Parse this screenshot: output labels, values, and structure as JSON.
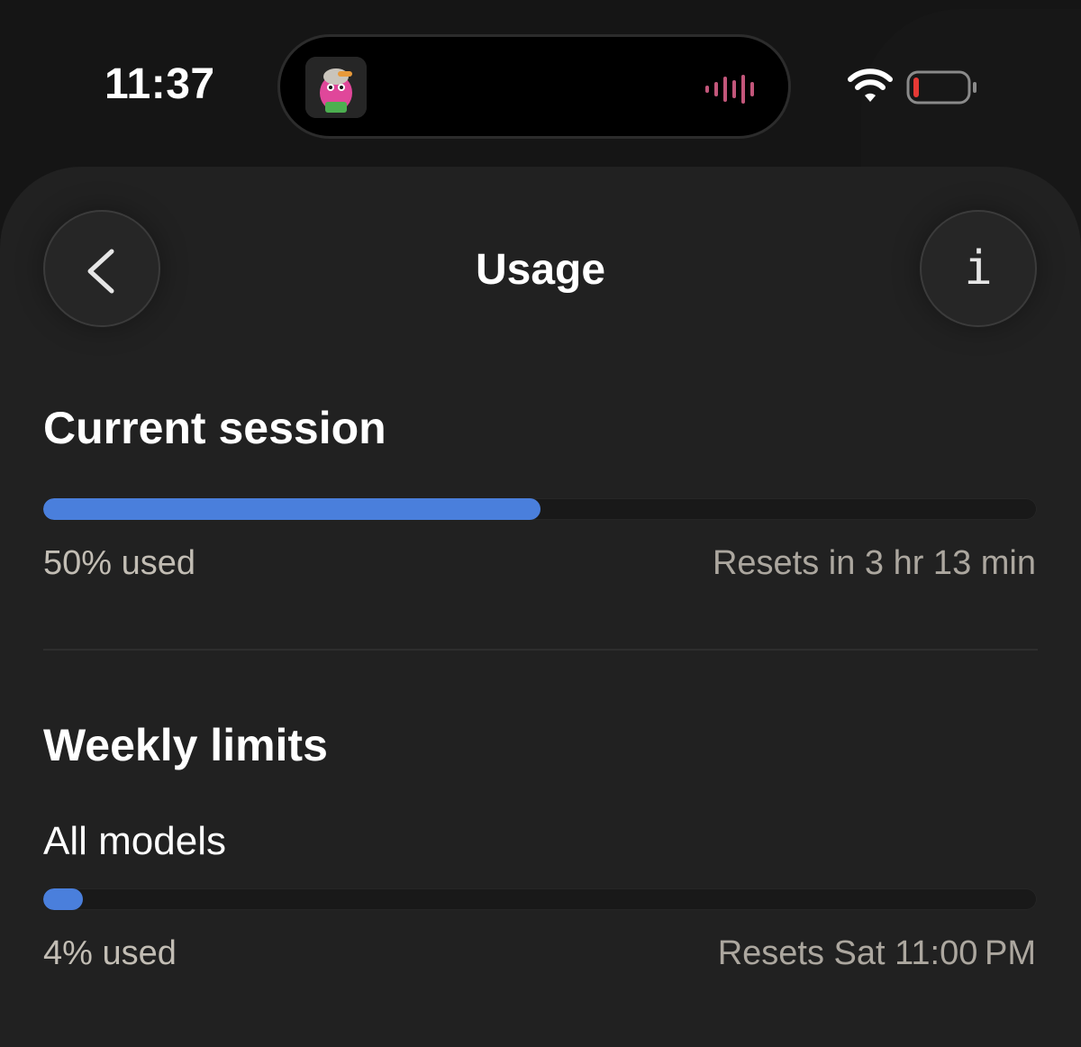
{
  "status_bar": {
    "time": "11:37",
    "icons": [
      "album-art-icon",
      "audio-waveform-icon",
      "wifi-icon",
      "battery-low-icon"
    ],
    "accent_colors": {
      "waveform": "#c2567a",
      "battery_low": "#e53935"
    }
  },
  "header": {
    "title": "Usage",
    "back_icon": "chevron-left-icon",
    "info_icon": "info-icon"
  },
  "current_session": {
    "heading": "Current session",
    "progress_percent": 50,
    "used_label": "50% used",
    "reset_label": "Resets in 3 hr 13 min"
  },
  "weekly_limits": {
    "heading": "Weekly limits",
    "all_models": {
      "label": "All models",
      "progress_percent": 4,
      "used_label": "4% used",
      "reset_label": "Resets Sat 11:00 PM"
    }
  },
  "colors": {
    "accent": "#4a7fdc",
    "background": "#212121",
    "text_primary": "#ffffff",
    "text_secondary": "#bdb8b0"
  }
}
